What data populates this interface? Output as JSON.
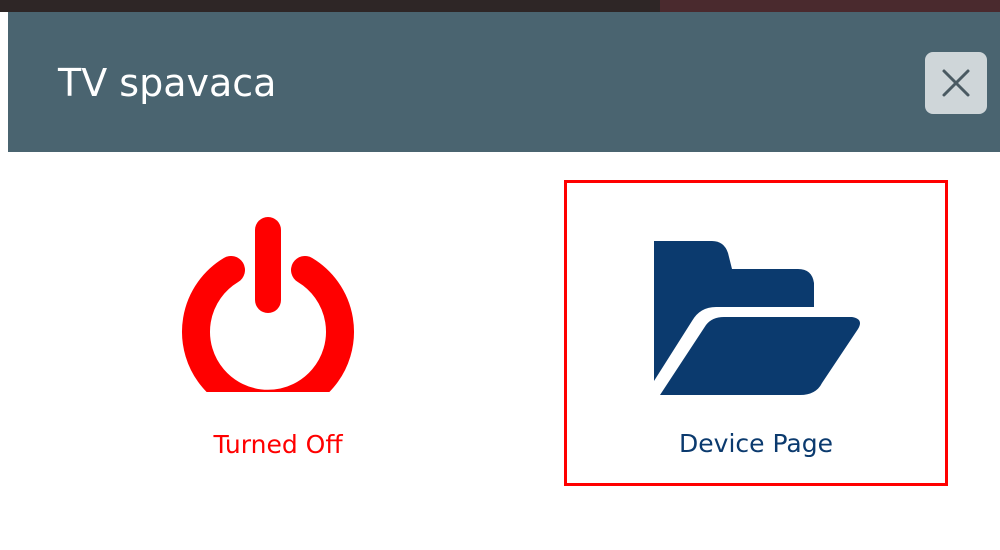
{
  "dialog": {
    "title": "TV spavaca",
    "close_icon": "close-icon"
  },
  "actions": [
    {
      "label": "Turned Off",
      "icon": "power-icon",
      "color": "#ff0000"
    },
    {
      "label": "Device Page",
      "icon": "folder-open-icon",
      "color": "#0b3a6e",
      "highlight_color": "#ff0000"
    }
  ],
  "colors": {
    "header_background": "#4a6470",
    "title_text": "#ffffff",
    "close_button_background": "#cfd6d9"
  }
}
